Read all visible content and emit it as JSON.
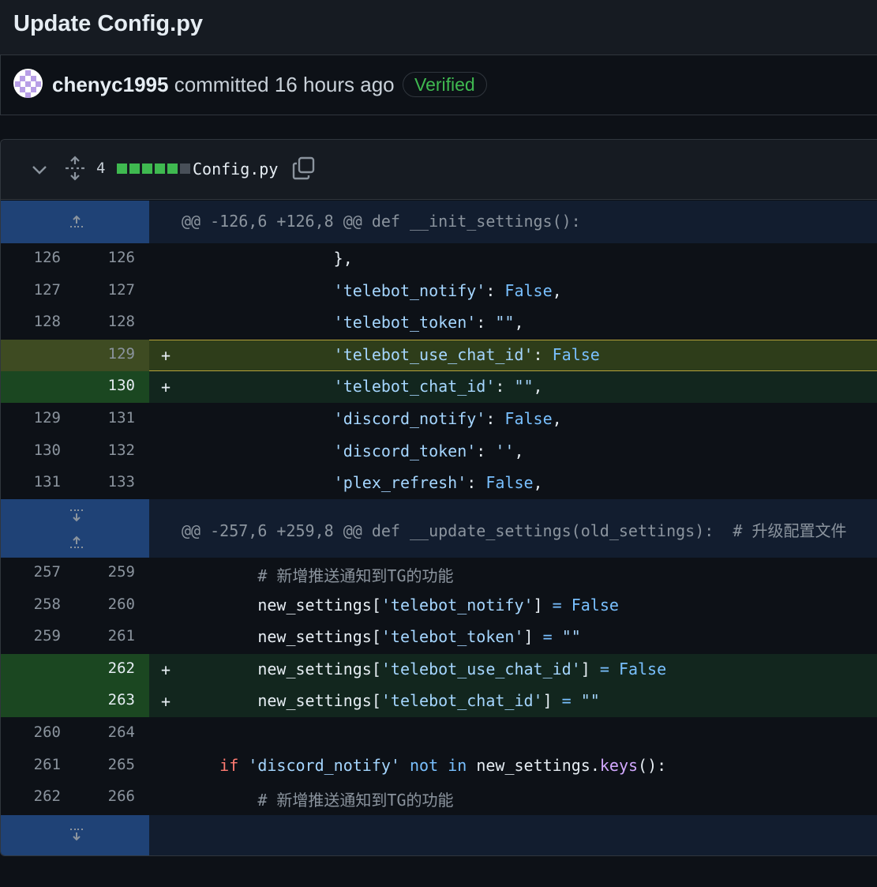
{
  "page": {
    "title": "Update Config.py"
  },
  "commit": {
    "author": "chenyc1995",
    "action": "committed",
    "time": "16 hours ago",
    "badge": "Verified"
  },
  "file": {
    "changes": "4",
    "name": "Config.py",
    "diffstat_colors": [
      "#3fb950",
      "#3fb950",
      "#3fb950",
      "#3fb950",
      "#3fb950",
      "#484f58"
    ]
  },
  "hunks": [
    {
      "header": "@@ -126,6 +126,8 @@ def __init_settings():"
    },
    {
      "header": "@@ -257,6 +259,8 @@ def __update_settings(old_settings):  # 升级配置文件"
    }
  ],
  "lines": [
    {
      "old": "126",
      "new": "126",
      "sign": "",
      "text": "                },",
      "type": "ctx"
    },
    {
      "old": "127",
      "new": "127",
      "sign": "",
      "text": "                'telebot_notify': False,",
      "type": "ctx"
    },
    {
      "old": "128",
      "new": "128",
      "sign": "",
      "text": "                'telebot_token': \"\",",
      "type": "ctx"
    },
    {
      "old": "",
      "new": "129",
      "sign": "+",
      "text": "                'telebot_use_chat_id': False",
      "type": "add-hl"
    },
    {
      "old": "",
      "new": "130",
      "sign": "+",
      "text": "                'telebot_chat_id': \"\",",
      "type": "add"
    },
    {
      "old": "129",
      "new": "131",
      "sign": "",
      "text": "                'discord_notify': False,",
      "type": "ctx"
    },
    {
      "old": "130",
      "new": "132",
      "sign": "",
      "text": "                'discord_token': '',",
      "type": "ctx"
    },
    {
      "old": "131",
      "new": "133",
      "sign": "",
      "text": "                'plex_refresh': False,",
      "type": "ctx"
    },
    {
      "old": "257",
      "new": "259",
      "sign": "",
      "text": "        # 新增推送通知到TG的功能",
      "type": "ctx"
    },
    {
      "old": "258",
      "new": "260",
      "sign": "",
      "text": "        new_settings['telebot_notify'] = False",
      "type": "ctx"
    },
    {
      "old": "259",
      "new": "261",
      "sign": "",
      "text": "        new_settings['telebot_token'] = \"\"",
      "type": "ctx"
    },
    {
      "old": "",
      "new": "262",
      "sign": "+",
      "text": "        new_settings['telebot_use_chat_id'] = False",
      "type": "add"
    },
    {
      "old": "",
      "new": "263",
      "sign": "+",
      "text": "        new_settings['telebot_chat_id'] = \"\"",
      "type": "add"
    },
    {
      "old": "260",
      "new": "264",
      "sign": "",
      "text": "",
      "type": "ctx"
    },
    {
      "old": "261",
      "new": "265",
      "sign": "",
      "text": "    if 'discord_notify' not in new_settings.keys():",
      "type": "ctx"
    },
    {
      "old": "262",
      "new": "266",
      "sign": "",
      "text": "        # 新增推送通知到TG的功能",
      "type": "ctx"
    }
  ]
}
